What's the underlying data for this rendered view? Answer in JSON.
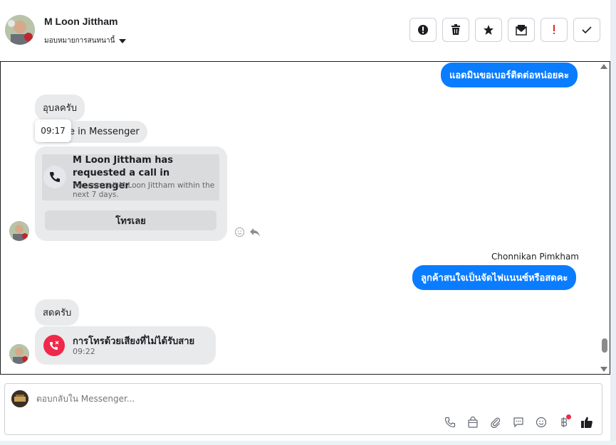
{
  "header": {
    "contact_name": "M Loon Jittham",
    "assign_label": "มอบหมายการสนทนานี้"
  },
  "messages": {
    "out_1": "แอดมินขอเบอร์ติดต่อหน่อยคะ",
    "in_1": "อุบลครับ",
    "tooltip_time": "09:17",
    "in_2_partial": "e in Messenger",
    "call_request": {
      "title": "M Loon Jittham has requested a call in Messenger",
      "desc": "You can call M Loon Jittham within the next 7 days.",
      "button": "โทรเลย"
    },
    "sender_2": "Chonnikan Pimkham",
    "out_2": "ลูกค้าสนใจเป็นจัดไฟแนนซ์หรือสดคะ",
    "in_3": "สดครับ",
    "missed_call": {
      "title": "การโทรด้วยเสียงที่ไม่ได้รับสาย",
      "time": "09:22"
    }
  },
  "composer": {
    "placeholder": "ตอบกลับใน Messenger..."
  },
  "colors": {
    "accent": "#0a7cff",
    "bubble_in": "#e9eaeb",
    "missed": "#f02849"
  }
}
